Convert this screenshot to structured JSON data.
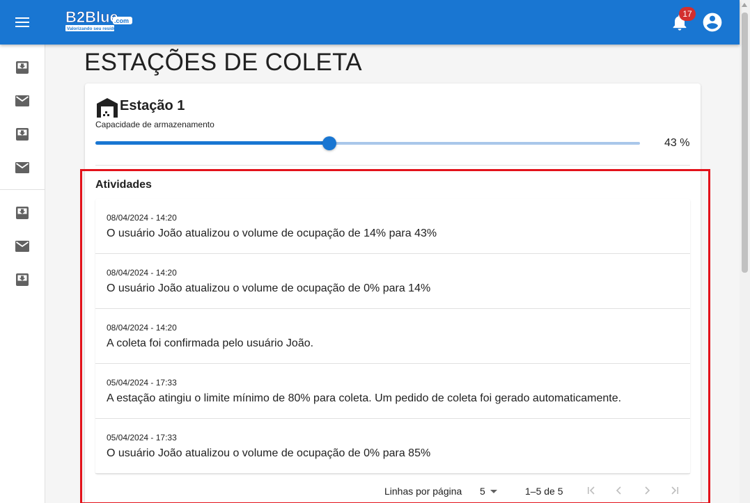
{
  "appbar": {
    "logo_text": "B2Blue",
    "logo_suffix": ".com",
    "logo_tagline": "Valorizando seu resíduo",
    "notification_count": "17",
    "color": "#1976d2"
  },
  "sidebar": {
    "items": [
      {
        "icon": "inbox-download-icon"
      },
      {
        "icon": "mail-icon"
      },
      {
        "icon": "inbox-download-icon"
      },
      {
        "icon": "mail-icon"
      },
      {
        "icon": "inbox-download-icon"
      },
      {
        "icon": "mail-icon"
      },
      {
        "icon": "inbox-download-icon"
      }
    ]
  },
  "page": {
    "title": "ESTAÇÕES DE COLETA"
  },
  "station": {
    "name": "Estação 1",
    "icon": "warehouse-icon",
    "capacity_label": "Capacidade de armazenamento",
    "capacity_value": "43 %",
    "capacity_fraction": 0.43
  },
  "activities": {
    "heading": "Atividades",
    "items": [
      {
        "date": "08/04/2024 - 14:20",
        "text": "O usuário João atualizou o volume de ocupação de 14% para 43%"
      },
      {
        "date": "08/04/2024 - 14:20",
        "text": "O usuário João atualizou o volume de ocupação de 0% para 14%"
      },
      {
        "date": "08/04/2024 - 14:20",
        "text": "A coleta foi confirmada pelo usuário João."
      },
      {
        "date": "05/04/2024 - 17:33",
        "text": "A estação atingiu o limite mínimo de 80% para coleta. Um pedido de coleta foi gerado automaticamente."
      },
      {
        "date": "05/04/2024 - 17:33",
        "text": "O usuário João atualizou o volume de ocupação de 0% para 85%"
      }
    ]
  },
  "pagination": {
    "rows_label": "Linhas por página",
    "rows_value": "5",
    "range": "1–5 de 5"
  },
  "highlight_color": "#e3121b"
}
